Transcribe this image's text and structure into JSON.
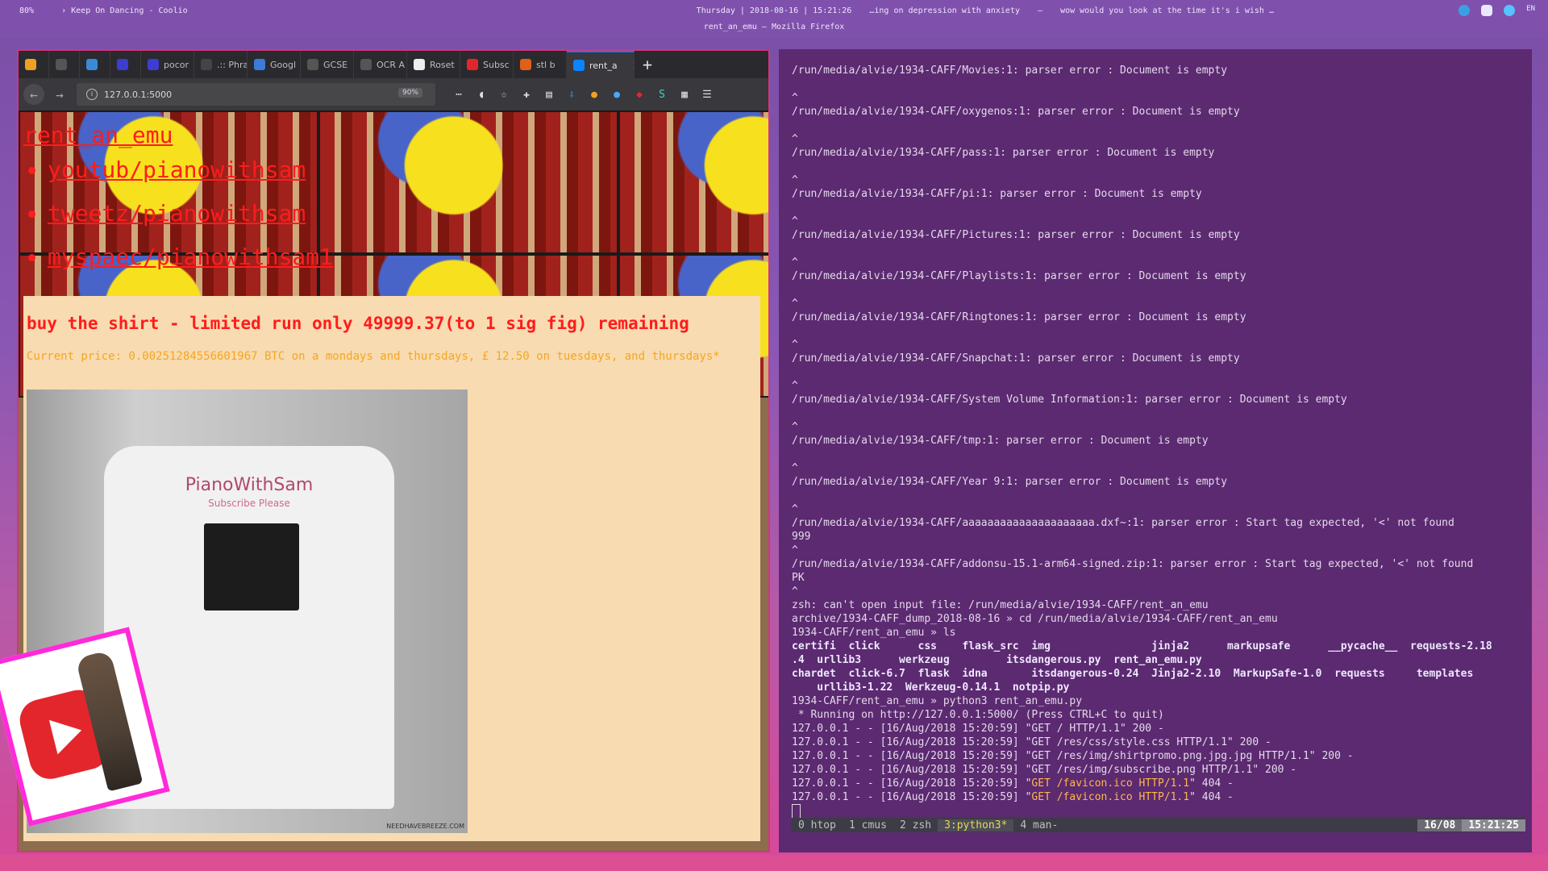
{
  "topbar": {
    "left": [
      "80%",
      "› Keep On Dancing - Coolio"
    ],
    "center_top": "Thursday | 2018-08-16 | 15:21:26",
    "center_bottom": "rent_an_emu — Mozilla Firefox",
    "right": [
      "…ing on depression with anxiety",
      "–",
      "wow would you look at the time it's i wish …"
    ],
    "lang": "EN"
  },
  "browser": {
    "tabs": [
      {
        "label": "",
        "color": "#f0a020"
      },
      {
        "label": "",
        "color": "#555555"
      },
      {
        "label": "",
        "color": "#3b8ad9"
      },
      {
        "label": "",
        "color": "#3d3dd1"
      },
      {
        "label": "pocor",
        "color": "#3d3dd1"
      },
      {
        "label": ".:: Phra",
        "color": "#444444"
      },
      {
        "label": "Googl",
        "color": "#3b7bd9"
      },
      {
        "label": "GCSE",
        "color": "#555555"
      },
      {
        "label": "OCR A",
        "color": "#555555"
      },
      {
        "label": "Roset",
        "color": "#eeeeee"
      },
      {
        "label": "Subsc",
        "color": "#e3262c"
      },
      {
        "label": "stl b",
        "color": "#e06018"
      },
      {
        "label": "rent_a",
        "color": "#0a84ff",
        "active": true
      }
    ],
    "new_tab": "+",
    "close": "×",
    "url": "127.0.0.1:5000",
    "zoom": "90%",
    "page": {
      "site_title": "rent_an_emu",
      "links": [
        "youtub/pianowithsam",
        "tweetz/pianowithsam",
        "myspaec/pianowithsam1"
      ],
      "shirt_heading": "buy the shirt - limited run only 49999.37(to 1 sig fig) remaining",
      "price_text": "Current price: 0.00251284556601967 BTC on a mondays and thursdays, £ 12.50 on tuesdays, and thursdays*",
      "shirt_logo": "PianoWithSam",
      "shirt_sub": "Subscribe Please",
      "watermark": "NEEDHAVEBREEZE.COM"
    }
  },
  "terminal": {
    "lines": [
      "/run/media/alvie/1934-CAFF/Movies:1: parser error : Document is empty",
      "",
      "^",
      "/run/media/alvie/1934-CAFF/oxygenos:1: parser error : Document is empty",
      "",
      "^",
      "/run/media/alvie/1934-CAFF/pass:1: parser error : Document is empty",
      "",
      "^",
      "/run/media/alvie/1934-CAFF/pi:1: parser error : Document is empty",
      "",
      "^",
      "/run/media/alvie/1934-CAFF/Pictures:1: parser error : Document is empty",
      "",
      "^",
      "/run/media/alvie/1934-CAFF/Playlists:1: parser error : Document is empty",
      "",
      "^",
      "/run/media/alvie/1934-CAFF/Ringtones:1: parser error : Document is empty",
      "",
      "^",
      "/run/media/alvie/1934-CAFF/Snapchat:1: parser error : Document is empty",
      "",
      "^",
      "/run/media/alvie/1934-CAFF/System Volume Information:1: parser error : Document is empty",
      "",
      "^",
      "/run/media/alvie/1934-CAFF/tmp:1: parser error : Document is empty",
      "",
      "^",
      "/run/media/alvie/1934-CAFF/Year 9:1: parser error : Document is empty",
      "",
      "^",
      "/run/media/alvie/1934-CAFF/aaaaaaaaaaaaaaaaaaaaa.dxf~:1: parser error : Start tag expected, '<' not found",
      "999",
      "^",
      "/run/media/alvie/1934-CAFF/addonsu-15.1-arm64-signed.zip:1: parser error : Start tag expected, '<' not found",
      "PK",
      "^",
      "zsh: can't open input file: /run/media/alvie/1934-CAFF/rent_an_emu",
      "archive/1934-CAFF_dump_2018-08-16 » cd /run/media/alvie/1934-CAFF/rent_an_emu",
      "1934-CAFF/rent_an_emu » ls"
    ],
    "ls_lines": [
      "certifi  click      css    flask_src  img                jinja2      markupsafe      __pycache__  requests-2.18",
      ".4  urllib3      werkzeug         itsdangerous.py  rent_an_emu.py",
      "chardet  click-6.7  flask  idna       itsdangerous-0.24  Jinja2-2.10  MarkupSafe-1.0  requests     templates",
      "    urllib3-1.22  Werkzeug-0.14.1  notpip.py"
    ],
    "after_lines": [
      "1934-CAFF/rent_an_emu » python3 rent_an_emu.py",
      " * Running on http://127.0.0.1:5000/ (Press CTRL+C to quit)",
      "127.0.0.1 - - [16/Aug/2018 15:20:59] \"GET / HTTP/1.1\" 200 -",
      "127.0.0.1 - - [16/Aug/2018 15:20:59] \"GET /res/css/style.css HTTP/1.1\" 200 -",
      "127.0.0.1 - - [16/Aug/2018 15:20:59] \"GET /res/img/shirtpromo.png.jpg.jpg HTTP/1.1\" 200 -",
      "127.0.0.1 - - [16/Aug/2018 15:20:59] \"GET /res/img/subscribe.png HTTP/1.1\" 200 -"
    ],
    "error_lines": [
      {
        "prefix": "127.0.0.1 - - [16/Aug/2018 15:20:59] \"",
        "hl": "GET /favicon.ico HTTP/1.1",
        "suffix": "\" 404 -"
      },
      {
        "prefix": "127.0.0.1 - - [16/Aug/2018 15:20:59] \"",
        "hl": "GET /favicon.ico HTTP/1.1",
        "suffix": "\" 404 -"
      }
    ],
    "status": {
      "windows": [
        "0 htop",
        "1 cmus",
        "2 zsh",
        "3:python3*",
        "4 man-"
      ],
      "current_index": 3,
      "date": "16/08",
      "time": "15:21:25"
    }
  }
}
